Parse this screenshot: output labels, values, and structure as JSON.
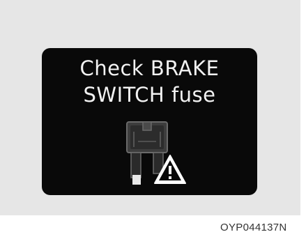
{
  "display": {
    "line1": "Check BRAKE",
    "line2": "SWITCH fuse",
    "icons": [
      "fuse-icon",
      "warning-triangle-icon"
    ]
  },
  "figure_code": "OYP044137N",
  "colors": {
    "background": "#e6e6e6",
    "display_bg": "#090909",
    "display_text": "#f2f2f2"
  }
}
